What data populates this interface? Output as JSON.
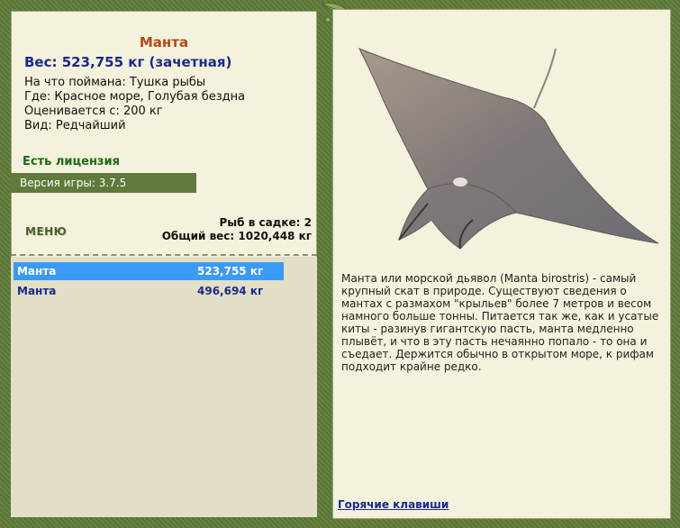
{
  "fish": {
    "name": "Манта",
    "weight_line": "Вес: 523,755 кг (зачетная)",
    "caught_with": "На что поймана: Тушка рыбы",
    "location": "Где: Красное море, Голубая бездна",
    "price": "Оценивается с: 200 кг",
    "rarity": "Вид: Редчайший"
  },
  "license": "Есть лицензия",
  "version": "Версия игры: 3.7.5",
  "menu_label": "МЕНЮ",
  "stats": {
    "fish_in_net": "Рыб в садке: 2",
    "total_weight": "Общий вес: 1020,448 кг"
  },
  "catch_list": [
    {
      "name": "Манта",
      "weight": "523,755 кг",
      "selected": true
    },
    {
      "name": "Манта",
      "weight": "496,694 кг",
      "selected": false
    }
  ],
  "description": "Манта или морской дьявол (Manta birostris) - самый крупный скат в природе. Существуют сведения о мантах с размахом \"крыльев\" более 7 метров и весом намного больше тонны. Питается так же, как и усатые киты - разинув гигантскую пасть, манта медленно плывёт, и что в эту пасть нечаянно попало - то она и съедает. Держится обычно в открытом море, к рифам подходит крайне редко.",
  "hotkeys_label": "Горячие клавиши",
  "colors": {
    "frame": "#5f7a3a",
    "panel": "#f4f1dc",
    "selected_row": "#3a9af5",
    "title": "#b0481a",
    "weight": "#1a2a8a"
  }
}
